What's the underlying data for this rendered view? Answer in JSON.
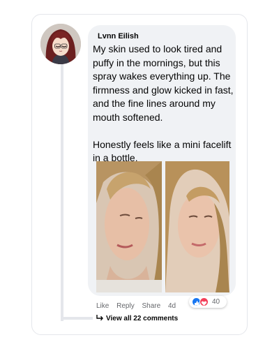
{
  "comment": {
    "author": "Lvnn Eilish",
    "paragraphs": [
      "My skin used to look tired and puffy in the mornings, but this spray wakes everything up. The firmness and glow kicked in fast, and the fine lines around my mouth softened.",
      "Honestly feels like a mini facelift in a bottle."
    ],
    "actions": {
      "like": "Like",
      "reply": "Reply",
      "share": "Share",
      "time": "4d"
    },
    "reactions": {
      "icons": [
        "like-icon",
        "love-icon"
      ],
      "count": "40"
    },
    "view_all": "View all 22 comments",
    "colors": {
      "bubble": "#f0f2f5",
      "like": "#1877f2",
      "love": "#f33e58",
      "muted_text": "#65676b"
    }
  }
}
